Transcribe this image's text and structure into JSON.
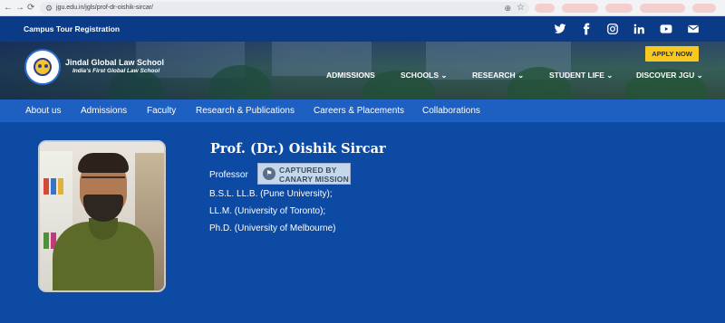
{
  "browser": {
    "back_icon": "←",
    "forward_icon": "→",
    "reload_icon": "⟳",
    "url": "jgu.edu.in/jgls/prof-dr-oishik-sircar/",
    "zoom_icon": "⊕",
    "star_icon": "☆"
  },
  "topbar": {
    "campus_tour": "Campus Tour Registration",
    "social_icons": [
      "twitter-icon",
      "facebook-icon",
      "instagram-icon",
      "linkedin-icon",
      "youtube-icon",
      "email-icon"
    ]
  },
  "header": {
    "school_name": "Jindal Global Law School",
    "tagline": "India's First Global Law School",
    "apply_label": "APPLY NOW",
    "menu": {
      "admissions": "ADMISSIONS",
      "schools": "SCHOOLS",
      "research": "RESEARCH",
      "student_life": "STUDENT LIFE",
      "discover": "DISCOVER JGU"
    }
  },
  "subnav": {
    "about": "About us",
    "admissions": "Admissions",
    "faculty": "Faculty",
    "research": "Research & Publications",
    "careers": "Careers & Placements",
    "collaborations": "Collaborations"
  },
  "profile": {
    "name": "Prof. (Dr.) Oishik Sircar",
    "title": "Professor",
    "stamp_line1": "CAPTURED BY",
    "stamp_line2": "CANARY MISSION",
    "degrees": [
      "B.S.L. LL.B. (Pune University);",
      "LL.M. (University of Toronto);",
      "Ph.D. (University of Melbourne)"
    ]
  },
  "colors": {
    "page_bg": "#0d4aa3",
    "topbar_bg": "#0b3a86",
    "subnav_bg": "#1e5fc2",
    "apply_bg": "#f7c81f"
  }
}
